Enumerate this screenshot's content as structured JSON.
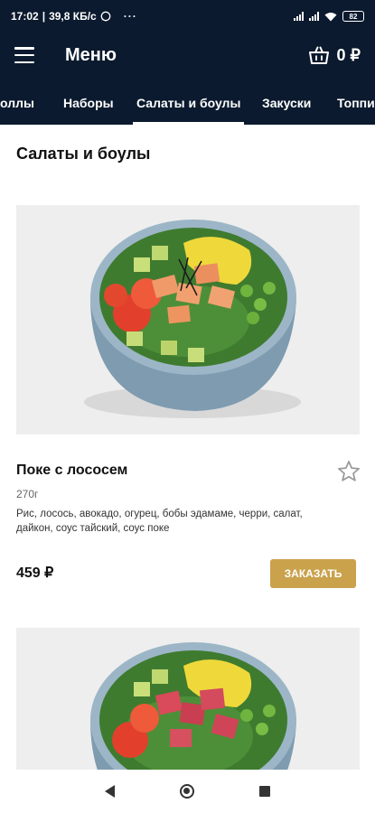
{
  "status_bar": {
    "time": "17:02",
    "speed": "39,8 КБ/с",
    "overflow_dots": "···",
    "battery": "82"
  },
  "app_bar": {
    "title": "Меню",
    "cart_total": "0 ₽"
  },
  "tabs": [
    {
      "label": "Роллы"
    },
    {
      "label": "Наборы"
    },
    {
      "label": "Салаты и боулы",
      "active": true
    },
    {
      "label": "Закуски"
    },
    {
      "label": "Топпинги"
    }
  ],
  "section": {
    "title": "Салаты и боулы"
  },
  "products": [
    {
      "name": "Поке с лососем",
      "weight": "270г",
      "description": "Рис, лосось, авокадо, огурец, бобы эдамаме, черри, салат, дайкон, соус тайский, соус поке",
      "price": "459 ₽",
      "order_label": "ЗАКАЗАТЬ"
    }
  ],
  "colors": {
    "header_bg": "#0b1a2e",
    "order_button": "#caa24c"
  },
  "icons": {
    "menu": "hamburger-icon",
    "cart": "basket-icon",
    "favorite": "star-outline-icon",
    "whatsapp": "whatsapp-icon",
    "wifi": "wifi-icon"
  }
}
